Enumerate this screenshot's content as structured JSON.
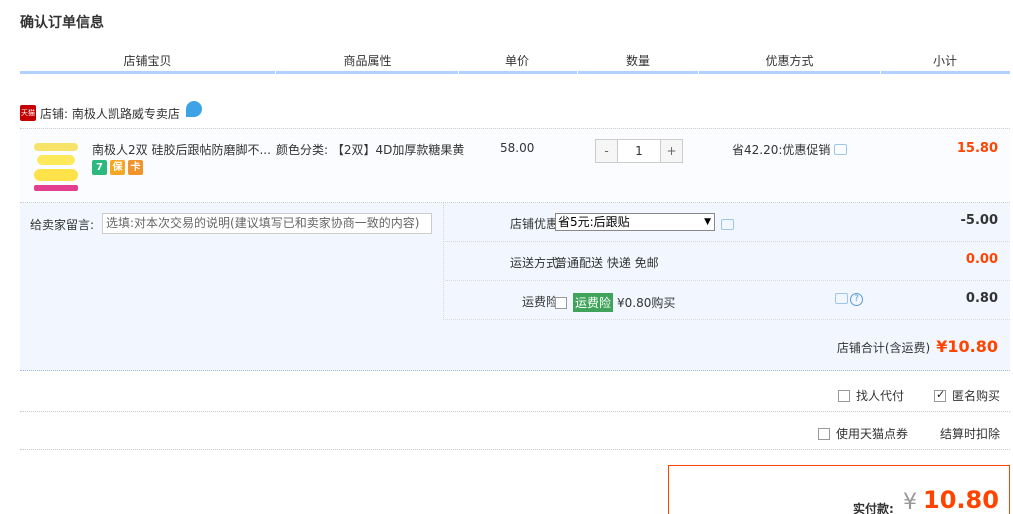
{
  "page": {
    "title": "确认订单信息"
  },
  "table_header": {
    "columns": [
      "店铺宝贝",
      "商品属性",
      "单价",
      "数量",
      "优惠方式",
      "小计"
    ]
  },
  "shop": {
    "badge": "天猫",
    "label": "店铺: 南极人凯路威专卖店"
  },
  "item": {
    "name": "南极人2双 硅胶后跟帖防磨脚不...",
    "attr": "颜色分类: 【2双】4D加厚款糖果黄",
    "price": "58.00",
    "qty_minus": "-",
    "qty_value": "1",
    "qty_plus": "+",
    "promo": "省42.20:优惠促销",
    "subtotal": "15.80",
    "service_icons": [
      "7",
      "保",
      "卡"
    ]
  },
  "message": {
    "label": "给卖家留言:",
    "placeholder": "选填:对本次交易的说明(建议填写已和卖家协商一致的内容)"
  },
  "shop_discount": {
    "label": "店铺优惠:",
    "selected": "省5元:后跟贴",
    "amount": "-5.00"
  },
  "shipping": {
    "label": "运送方式:",
    "value": "普通配送 快递 免邮",
    "amount": "0.00"
  },
  "insurance": {
    "label": "运费险:",
    "tag": "运费险",
    "desc": "¥0.80购买",
    "amount": "0.80",
    "help": "?"
  },
  "shop_total": {
    "label": "店铺合计(含运费)",
    "amount": "¥10.80"
  },
  "options": {
    "proxy_pay": "找人代付",
    "anonymous": "匿名购买",
    "tmall_points": "使用天猫点券",
    "points_note": "结算时扣除"
  },
  "pay": {
    "label": "实付款:",
    "currency": "¥",
    "amount": "10.80"
  },
  "colors": {
    "accent": "#ff4400",
    "header_line": "#b2d1ff",
    "panel_bg": "#f2f7ff"
  }
}
